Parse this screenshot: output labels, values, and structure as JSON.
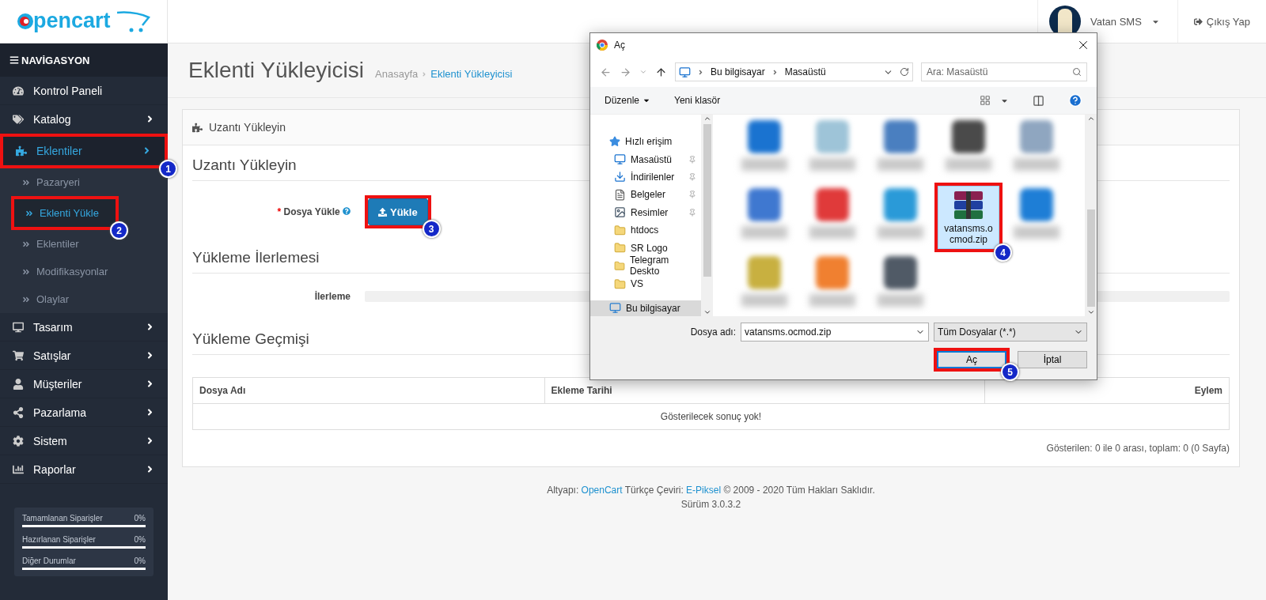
{
  "header": {
    "logo": "pencart",
    "user": "Vatan SMS",
    "logout": "Çıkış Yap"
  },
  "sidebar": {
    "title": "NAVİGASYON",
    "items": [
      {
        "label": "Kontrol Paneli",
        "kind": "link",
        "selected": false
      },
      {
        "label": "Katalog",
        "kind": "group",
        "selected": false
      },
      {
        "label": "Eklentiler",
        "kind": "group",
        "selected": true,
        "callout": "1",
        "children": [
          {
            "label": "Pazaryeri",
            "selected": false
          },
          {
            "label": "Eklenti Yükle",
            "selected": true,
            "callout": "2"
          },
          {
            "label": "Eklentiler",
            "selected": false
          },
          {
            "label": "Modifikasyonlar",
            "selected": false
          },
          {
            "label": "Olaylar",
            "selected": false
          }
        ]
      },
      {
        "label": "Tasarım",
        "kind": "group",
        "selected": false
      },
      {
        "label": "Satışlar",
        "kind": "group",
        "selected": false
      },
      {
        "label": "Müşteriler",
        "kind": "group",
        "selected": false
      },
      {
        "label": "Pazarlama",
        "kind": "group",
        "selected": false
      },
      {
        "label": "Sistem",
        "kind": "group",
        "selected": false
      },
      {
        "label": "Raporlar",
        "kind": "group",
        "selected": false
      }
    ],
    "stats": [
      {
        "label": "Tamamlanan Siparişler",
        "value": "0%",
        "level": 0
      },
      {
        "label": "Hazırlanan Siparişler",
        "value": "0%",
        "level": 0
      },
      {
        "label": "Diğer Durumlar",
        "value": "0%",
        "level": 0
      }
    ]
  },
  "page": {
    "title": "Eklenti Yükleyicisi",
    "breadcrumb": [
      {
        "label": "Anasayfa",
        "selected": false
      },
      {
        "label": "Eklenti Yükleyicisi",
        "selected": true
      }
    ]
  },
  "panel": {
    "heading": "Uzantı Yükleyin",
    "upload_legend": "Uzantı Yükleyin",
    "file_label": "Dosya Yükle",
    "required_mark": "*",
    "upload_button": "Yükle",
    "upload_callout": "3",
    "progress_legend": "Yükleme İlerlemesi",
    "progress_label": "İlerleme",
    "progress": {
      "level": 0
    },
    "history_legend": "Yükleme Geçmişi",
    "columns": [
      "Dosya Adı",
      "Ekleme Tarihi",
      "Eylem"
    ],
    "empty": "Gösterilecek sonuç yok!",
    "pagination": "Gösterilen: 0 ile 0 arası, toplam: 0 (0 Sayfa)"
  },
  "footer": {
    "segments": [
      {
        "text": "Altyapı: ",
        "link": false
      },
      {
        "text": "OpenCart",
        "link": true
      },
      {
        "text": " Türkçe Çeviri: ",
        "link": false
      },
      {
        "text": "E-Piksel",
        "link": true
      },
      {
        "text": " © 2009 - 2020 Tüm Hakları Saklıdır.",
        "link": false
      }
    ],
    "version": "Sürüm 3.0.3.2"
  },
  "dialog": {
    "title": "Aç",
    "path": [
      "Bu bilgisayar",
      "Masaüstü"
    ],
    "search": {
      "placeholder": "Ara: Masaüstü"
    },
    "toolbar": [
      "Düzenle",
      "Yeni klasör"
    ],
    "nav": [
      {
        "label": "Hızlı erişim",
        "kind": "star",
        "pinned": false,
        "selected": false
      },
      {
        "label": "Masaüstü",
        "kind": "desktop",
        "pinned": true,
        "selected": false
      },
      {
        "label": "İndirilenler",
        "kind": "download",
        "pinned": true,
        "selected": false
      },
      {
        "label": "Belgeler",
        "kind": "document",
        "pinned": true,
        "selected": false
      },
      {
        "label": "Resimler",
        "kind": "picture",
        "pinned": true,
        "selected": false
      },
      {
        "label": "htdocs",
        "kind": "folder",
        "pinned": false,
        "selected": false
      },
      {
        "label": "SR Logo",
        "kind": "folder",
        "pinned": false,
        "selected": false
      },
      {
        "label": "Telegram Deskto",
        "kind": "folder",
        "pinned": false,
        "selected": false
      },
      {
        "label": "VS",
        "kind": "folder",
        "pinned": false,
        "selected": false
      },
      {
        "label": "Bu bilgisayar",
        "kind": "computer",
        "pinned": false,
        "selected": true
      }
    ],
    "files": [
      {
        "kind": "blurred",
        "color": "#1a73d0",
        "selected": false
      },
      {
        "kind": "blurred",
        "color": "#9ec4d8",
        "selected": false
      },
      {
        "kind": "blurred",
        "color": "#4a7fc0",
        "selected": false
      },
      {
        "kind": "blurred",
        "color": "#4a4a4a",
        "selected": false
      },
      {
        "kind": "blurred",
        "color": "#8fa6c0",
        "selected": false
      },
      {
        "kind": "blurred",
        "color": "#3f78d0",
        "selected": false
      },
      {
        "kind": "blurred",
        "color": "#e03a3a",
        "selected": false
      },
      {
        "kind": "blurred",
        "color": "#2a9ad8",
        "selected": false
      },
      {
        "kind": "archive",
        "label": "vatansms.ocmod.zip",
        "selected": true,
        "callout": "4"
      },
      {
        "kind": "blurred",
        "color": "#1e7ed6",
        "selected": false
      },
      {
        "kind": "blurred",
        "color": "#c8b040",
        "selected": false
      },
      {
        "kind": "blurred",
        "color": "#f08030",
        "selected": false
      },
      {
        "kind": "blurred",
        "color": "#505a66",
        "selected": false
      }
    ],
    "filename_label": "Dosya adı:",
    "filename": "vatansms.ocmod.zip",
    "filter": "Tüm Dosyalar (*.*)",
    "open_button": "Aç",
    "open_callout": "5",
    "cancel_button": "İptal"
  }
}
